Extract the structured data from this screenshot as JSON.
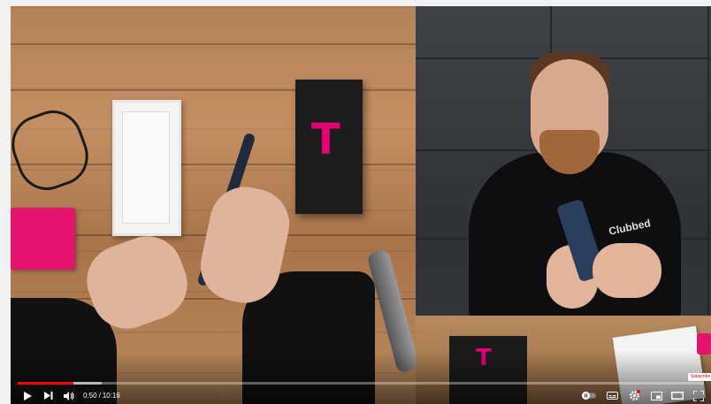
{
  "player": {
    "current_time": "0:50",
    "separator": "/",
    "duration": "10:16",
    "progress": {
      "played_fraction": 0.081,
      "buffered_fraction": 0.123
    }
  },
  "scene": {
    "left_box_brand": "T",
    "right_box_brand": "T",
    "hoodie_print": "Clubbed",
    "subscribe_badge": "Subscribe",
    "colors": {
      "magenta": "#e20074",
      "progress_red": "#ff0000"
    }
  },
  "controls": {
    "icons": [
      "play-icon",
      "next-icon",
      "volume-icon",
      "autoplay-toggle-icon",
      "captions-icon",
      "settings-icon",
      "miniplayer-icon",
      "theater-icon",
      "fullscreen-icon"
    ],
    "settings_badge": "HD"
  }
}
